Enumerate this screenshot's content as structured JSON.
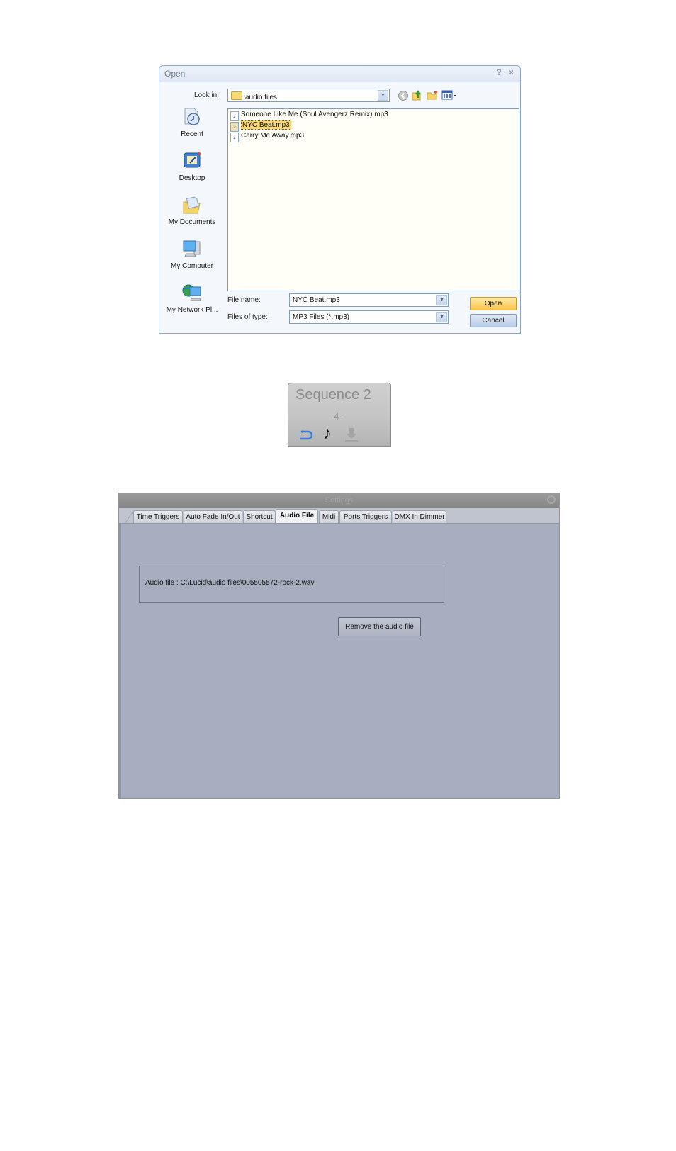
{
  "open_dialog": {
    "title": "Open",
    "help_glyph": "?",
    "close_glyph": "×",
    "look_in_label": "Look in:",
    "look_in_value": "audio files",
    "toolbar_icons": [
      "back-icon",
      "up-folder-icon",
      "new-folder-icon",
      "views-menu-icon"
    ],
    "places": [
      {
        "label": "Recent",
        "icon": "recent-icon"
      },
      {
        "label": "Desktop",
        "icon": "desktop-icon"
      },
      {
        "label": "My Documents",
        "icon": "my-documents-icon"
      },
      {
        "label": "My Computer",
        "icon": "my-computer-icon"
      },
      {
        "label": "My Network Pl...",
        "icon": "my-network-icon"
      }
    ],
    "files": [
      {
        "name": "Someone Like Me (Soul Avengerz Remix).mp3",
        "selected": false
      },
      {
        "name": "NYC Beat.mp3",
        "selected": true
      },
      {
        "name": "Carry Me Away.mp3",
        "selected": false
      }
    ],
    "file_name_label": "File name:",
    "file_name_value": "NYC Beat.mp3",
    "file_type_label": "Files of type:",
    "file_type_value": "MP3 Files (*.mp3)",
    "open_button": "Open",
    "cancel_button": "Cancel"
  },
  "sequence_widget": {
    "title": "Sequence 2",
    "subtitle": "4 -",
    "icons": [
      "loop-icon",
      "music-note-icon",
      "download-icon"
    ]
  },
  "settings_panel": {
    "title": "Settings",
    "tabs": [
      {
        "label": "Time Triggers",
        "active": false
      },
      {
        "label": "Auto Fade In/Out",
        "active": false
      },
      {
        "label": "Shortcut",
        "active": false
      },
      {
        "label": "Audio File",
        "active": true
      },
      {
        "label": "Midi",
        "active": false
      },
      {
        "label": "Ports Triggers",
        "active": false
      },
      {
        "label": "DMX In Dimmer",
        "active": false
      }
    ],
    "audio_file_text": "Audio file : C:\\Lucid\\audio files\\005505572-rock-2.wav",
    "remove_button": "Remove the audio file"
  }
}
